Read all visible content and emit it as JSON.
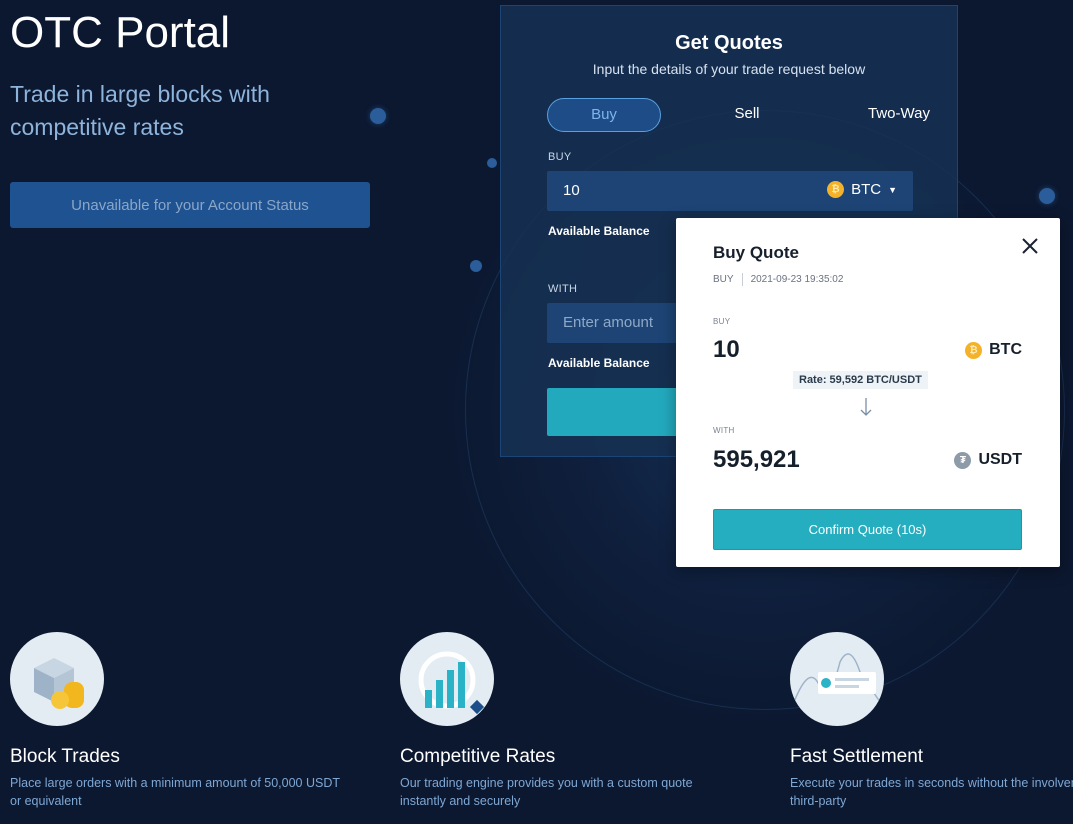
{
  "hero": {
    "title": "OTC Portal",
    "subtitle": "Trade in large blocks with competitive rates",
    "status_button_label": "Unavailable for your Account Status"
  },
  "quote_form": {
    "title": "Get Quotes",
    "subtitle": "Input the details of your trade request below",
    "tabs": [
      {
        "label": "Buy",
        "active": true
      },
      {
        "label": "Sell",
        "active": false
      },
      {
        "label": "Two-Way",
        "active": false
      }
    ],
    "buy_label": "BUY",
    "buy_value": "10",
    "buy_asset": "BTC",
    "buy_asset_icon": "btc-coin-icon",
    "available_balance_label": "Available Balance",
    "with_label": "WITH",
    "with_placeholder": "Enter amount",
    "with_available_balance_label": "Available Balance"
  },
  "buy_quote_modal": {
    "title": "Buy Quote",
    "side": "BUY",
    "timestamp": "2021-09-23 19:35:02",
    "buy_label": "BUY",
    "buy_amount": "10",
    "buy_asset": "BTC",
    "rate": "Rate: 59,592 BTC/USDT",
    "with_label": "WITH",
    "with_amount": "595,921",
    "with_asset": "USDT",
    "with_asset_icon": "usdt-coin-icon",
    "confirm_button_label": "Confirm Quote (10s)"
  },
  "features": [
    {
      "icon": "blocks-coins-icon",
      "title": "Block Trades",
      "description": "Place large orders with a minimum amount of 50,000 USDT or equivalent"
    },
    {
      "icon": "magnifier-chart-icon",
      "title": "Competitive Rates",
      "description": "Our trading engine provides you with a custom quote instantly and securely"
    },
    {
      "icon": "fast-settlement-icon",
      "title": "Fast Settlement",
      "description": "Execute your trades in seconds without the involvement of a third-party"
    }
  ],
  "colors": {
    "background": "#0c1830",
    "accent_teal": "#25aebf",
    "panel": "#163154",
    "btc": "#f4b22a"
  }
}
